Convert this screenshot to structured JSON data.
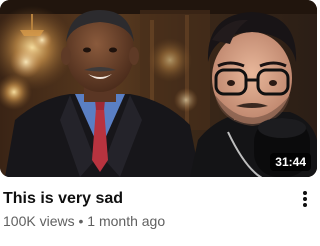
{
  "video": {
    "title": "This is very sad",
    "views": "100K views",
    "separator": "•",
    "age": "1 month ago",
    "duration": "31:44"
  },
  "icons": {
    "menu": "more-vert-icon"
  },
  "colors": {
    "title_text": "#0f0f0f",
    "meta_text": "#606060",
    "badge_background": "#000000",
    "badge_text": "#ffffff"
  }
}
